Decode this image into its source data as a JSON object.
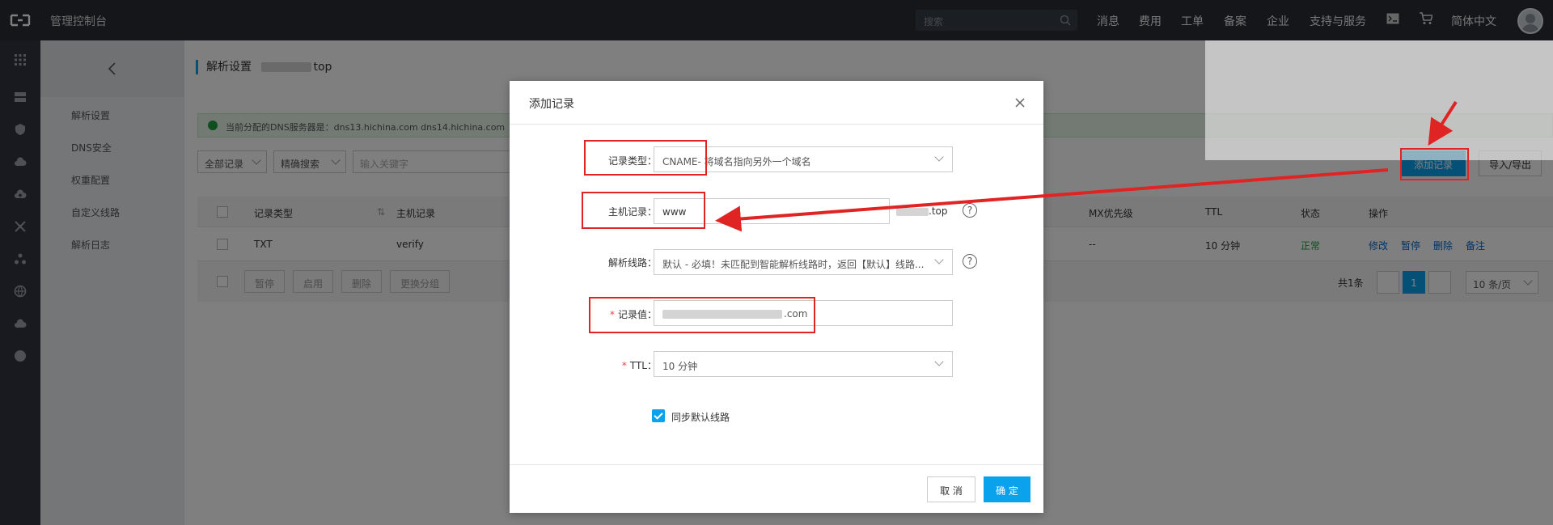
{
  "header": {
    "app_title": "管理控制台",
    "search_placeholder": "搜索",
    "nav": [
      "消息",
      "费用",
      "工单",
      "备案",
      "企业",
      "支持与服务",
      "简体中文"
    ]
  },
  "subnav": {
    "items": [
      "解析设置",
      "DNS安全",
      "权重配置",
      "自定义线路",
      "解析日志"
    ]
  },
  "page": {
    "title": "解析设置",
    "domain_suffix": "top",
    "notice": "当前分配的DNS服务器是：dns13.hichina.com  dns14.hichina.com",
    "filter_all": "全部记录",
    "filter_exact": "精确搜索",
    "keyword_placeholder": "输入关键字",
    "add_record_btn": "添加记录",
    "import_export_btn": "导入/导出",
    "columns": [
      "记录类型",
      "主机记录",
      "MX优先级",
      "TTL",
      "状态",
      "操作"
    ],
    "rows": [
      {
        "type": "TXT",
        "host": "verify",
        "mx": "--",
        "ttl": "10 分钟",
        "status": "正常",
        "actions": [
          "修改",
          "暂停",
          "删除",
          "备注"
        ]
      }
    ],
    "bulk_actions": [
      "暂停",
      "启用",
      "删除",
      "更换分组"
    ],
    "total": "共1条",
    "current_page": "1",
    "page_size": "10 条/页"
  },
  "modal": {
    "title": "添加记录",
    "type_label": "记录类型：",
    "type_value": "CNAME- 将域名指向另外一个域名",
    "host_label": "主机记录：",
    "host_value": "www",
    "host_suffix": ".top",
    "line_label": "解析线路：",
    "line_value": "默认 - 必填！未匹配到智能解析线路时，返回【默认】线路...",
    "value_label": "记录值：",
    "value_suffix": ".com",
    "ttl_label": "TTL：",
    "ttl_value": "10 分钟",
    "sync_label": "同步默认线路",
    "cancel": "取 消",
    "ok": "确 定",
    "help_glyph": "?",
    "required_mark": "*"
  },
  "colors": {
    "accent": "#0aa1ed",
    "annotation_red": "#e02424",
    "topbar": "#282c32",
    "success": "#1e9f3c"
  },
  "icons": [
    "logo-icon",
    "search-icon",
    "apps-icon",
    "terminal-icon",
    "cart-icon",
    "close-icon",
    "chevron-left-icon"
  ]
}
